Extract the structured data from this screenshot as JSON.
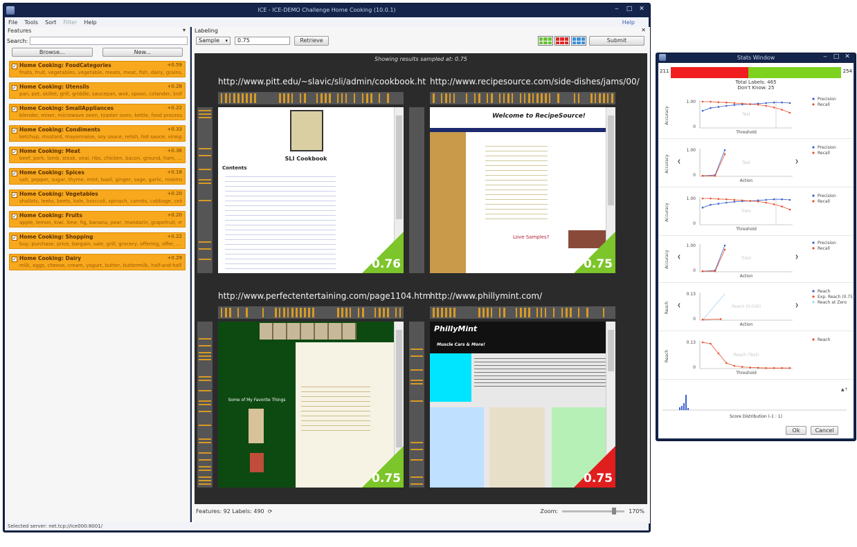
{
  "main_window": {
    "title": "ICE - ICE-DEMO Challenge Home Cooking (10.0.1)",
    "menu": [
      {
        "label": "File",
        "enabled": true
      },
      {
        "label": "Tools",
        "enabled": true
      },
      {
        "label": "Sort",
        "enabled": true
      },
      {
        "label": "Filter",
        "enabled": false
      },
      {
        "label": "Help",
        "enabled": true
      }
    ],
    "help_link": "Help"
  },
  "features_panel": {
    "title": "Features",
    "search_label": "Search:",
    "search_value": "",
    "browse_label": "Browse...",
    "new_label": "New...",
    "items": [
      {
        "name": "Home Cooking: FoodCategories",
        "score": "+0.59",
        "terms": "fruits, fruit, vegetables, vegetable, meats, meat, fish, dairy, grains, grain, ..."
      },
      {
        "name": "Home Cooking: Utensils",
        "score": "+0.28",
        "terms": "pan, pot, skillet, grill, griddle, saucepan, wok, spoon, colander, knife, ..."
      },
      {
        "name": "Home Cooking: SmallAppliances",
        "score": "+0.22",
        "terms": "blender, mixer, microwave oven, toaster oven, kettle, food processor, ..."
      },
      {
        "name": "Home Cooking: Condiments",
        "score": "+0.33",
        "terms": "ketchup, mustard, mayonnaise, soy sauce, relish, hot sauce, vinegar, ..."
      },
      {
        "name": "Home Cooking: Meat",
        "score": "+0.36",
        "terms": "beef, pork, lamb, steak, veal, ribs, chicken, bacon, ground, ham, ..."
      },
      {
        "name": "Home Cooking: Spices",
        "score": "+0.18",
        "terms": "salt, pepper, sugar, thyme, mint, basil, ginger, sage, garlic, rosemary, ..."
      },
      {
        "name": "Home Cooking: Vegetables",
        "score": "+0.20",
        "terms": "shallots, leeks, beets, kale, broccoli, spinach, carrots, cabbage, celery, ..."
      },
      {
        "name": "Home Cooking: Fruits",
        "score": "+0.20",
        "terms": "apple, lemon, kiwi, lime, fig, banana, pear, mandarin, grapefruit, mango, ..."
      },
      {
        "name": "Home Cooking: Shopping",
        "score": "+0.22",
        "terms": "buy, purchase, price, bargain, sale, grill, grocery, offering, offer, ..."
      },
      {
        "name": "Home Cooking: Dairy",
        "score": "+0.29",
        "terms": "milk, eggs, cheese, cream, yogurt, butter, buttermilk, half-and-half, ..."
      }
    ]
  },
  "labeling": {
    "title": "Labeling",
    "mode": "Sample",
    "threshold_value": "0.75",
    "retrieve_label": "Retrieve",
    "submit_label": "Submit",
    "caption": "Showing results sampled at: 0.75",
    "results": [
      {
        "url": "http://www.pitt.edu/~slavic/sli/admin/cookbook.ht",
        "score": "0.76",
        "status": "positive",
        "page_heading": "SLI Cookbook",
        "page_sub": "Contents"
      },
      {
        "url": "http://www.recipesource.com/side-dishes/jams/00/",
        "score": "0.75",
        "status": "positive",
        "page_heading": "Welcome to RecipeSource!",
        "page_sub": "Love Samples?"
      },
      {
        "url": "http://www.perfectentertaining.com/page1104.htm",
        "score": "0.75",
        "status": "positive",
        "page_heading": "",
        "page_sub": "Some of My Favorite Things"
      },
      {
        "url": "http://www.phillymint.com/",
        "score": "0.75",
        "status": "negative",
        "page_heading": "PhillyMint",
        "page_sub": "Muscle Cars & More!"
      }
    ],
    "status_left": "Features: 92  Labels: 490",
    "zoom_label": "Zoom:",
    "zoom_value": "170%",
    "zoom_fraction": 0.85
  },
  "status_bar": "Selected server: net.tcp://ice000:8001/",
  "stats_window": {
    "title": "Stats Window",
    "neg_count": "211",
    "pos_count": "254",
    "total_labels": "Total Labels: 465",
    "dont_know": "Don't Know: 25",
    "ok_label": "Ok",
    "cancel_label": "Cancel",
    "neg_fraction": 0.454,
    "legend_precision": "Precision",
    "legend_recall": "Recall",
    "legend_reach": "Reach",
    "legend_exp_reach": "Exp. Reach (0.75)",
    "legend_reach_zero": "Reach at Zero",
    "axis_threshold": "Threshold",
    "axis_action": "Action",
    "axis_accuracy": "Accuracy",
    "axis_reach": "Reach",
    "score_distribution": "Score Distribution (-1 : 1)",
    "panels": [
      {
        "kind": "threshold",
        "label": "Test",
        "ylabel": "Accuracy",
        "xlabel": "Threshold",
        "ytop": "1.00",
        "ybottom": "0"
      },
      {
        "kind": "action",
        "label": "Test",
        "ylabel": "Accuracy",
        "xlabel": "Action",
        "ytop": "1.00",
        "ybottom": "0"
      },
      {
        "kind": "threshold",
        "label": "Train",
        "ylabel": "Accuracy",
        "xlabel": "Threshold",
        "ytop": "1.00",
        "ybottom": "0"
      },
      {
        "kind": "action",
        "label": "Train",
        "ylabel": "Accuracy",
        "xlabel": "Action",
        "ytop": "1.00",
        "ybottom": "0"
      },
      {
        "kind": "reach-action",
        "label": "Reach (0.026)",
        "ylabel": "Reach",
        "xlabel": "Action",
        "ytop": "0.13",
        "ybottom": "0"
      },
      {
        "kind": "reach-threshold",
        "label": "Reach (Test)",
        "ylabel": "Reach",
        "xlabel": "Threshold",
        "ytop": "0.13",
        "ybottom": "0"
      }
    ],
    "colors": {
      "precision": "#3a5fcd",
      "recall": "#e8502a",
      "reach_zero": "#9fd0f0"
    }
  }
}
